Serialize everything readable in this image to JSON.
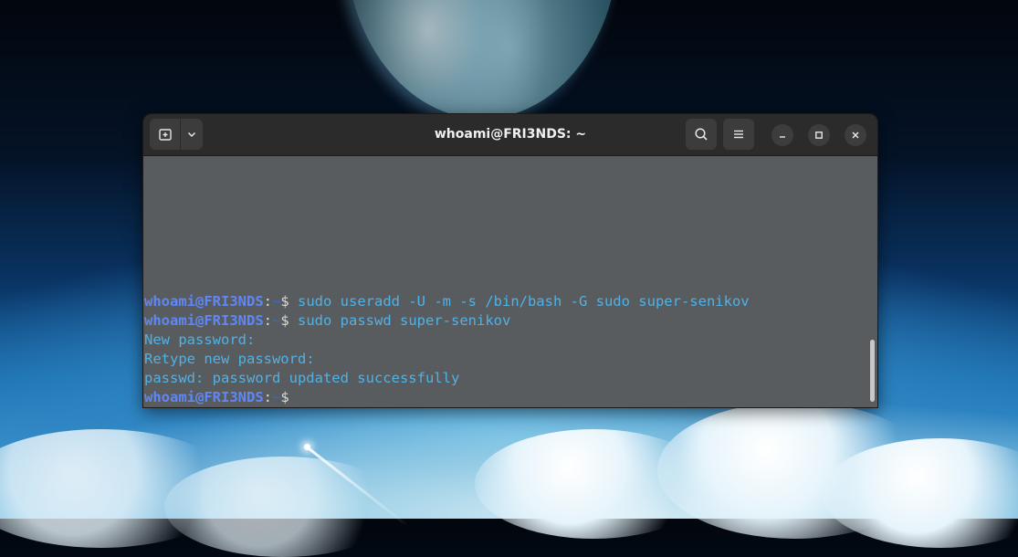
{
  "window": {
    "title": "whoami@FRI3NDS: ~"
  },
  "icons": {
    "new_tab": "new-tab-icon",
    "dropdown": "chevron-down-icon",
    "search": "search-icon",
    "menu": "hamburger-menu-icon",
    "minimize": "minimize-icon",
    "maximize": "maximize-icon",
    "close": "close-icon"
  },
  "terminal": {
    "prompt": {
      "user_host": "whoami@FRI3NDS",
      "colon": ":",
      "path": "~",
      "dollar": "$"
    },
    "lines": [
      {
        "type": "prompt",
        "command": " sudo useradd -U -m -s /bin/bash -G sudo super-senikov"
      },
      {
        "type": "prompt",
        "command": " sudo passwd super-senikov"
      },
      {
        "type": "output",
        "text": "New password:"
      },
      {
        "type": "output",
        "text": "Retype new password:"
      },
      {
        "type": "output",
        "text": "passwd: password updated successfully"
      },
      {
        "type": "prompt",
        "command": ""
      }
    ]
  },
  "colors": {
    "user_host": "#5f87f5",
    "path": "#2a6fd6",
    "text": "#4fb2e6",
    "terminal_bg": "#595c5f",
    "titlebar_bg": "#2b2b2b"
  }
}
